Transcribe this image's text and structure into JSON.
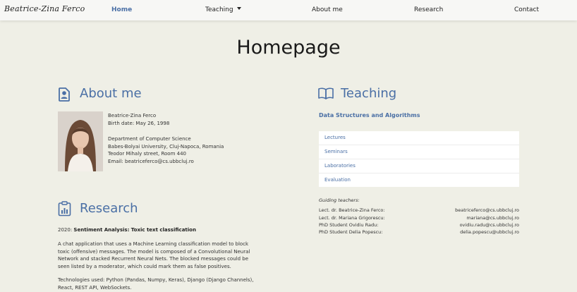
{
  "navbar": {
    "brand": "Beatrice-Zina Ferco",
    "links": {
      "home": "Home",
      "teaching": "Teaching",
      "about": "About me",
      "research": "Research",
      "contact": "Contact"
    },
    "active": "Home"
  },
  "page_title": "Homepage",
  "about": {
    "heading": "About me",
    "name": "Beatrice-Zina Ferco",
    "birth": "Birth date: May 26, 1998",
    "department": "Department of Computer Science",
    "university": "Babes-Bolyai University, Cluj-Napoca, Romania",
    "address": "Teodor Mihaly street, Room 440",
    "email": "Email: beatriceferco@cs.ubbcluj.ro"
  },
  "teaching": {
    "heading": "Teaching",
    "course_title": "Data Structures and Algorithms",
    "items": [
      "Lectures",
      "Seminars",
      "Laboratories",
      "Evaluation"
    ],
    "guiding_label": "Guiding teachers:",
    "teachers": [
      {
        "name": "Lect. dr. Beatrice-Zina Ferco:",
        "email": "beatriceferco@cs.ubbcluj.ro"
      },
      {
        "name": "Lect. dr. Mariana Grigorescu:",
        "email": "mariana@cs.ubbcluj.ro"
      },
      {
        "name": "PhD Student Ovidiu Radu:",
        "email": "ovidiu.radu@cs.ubbcluj.ro"
      },
      {
        "name": "PhD Student Delia Popescu:",
        "email": "delia.popescu@ubbcluj.ro"
      }
    ]
  },
  "research": {
    "heading": "Research",
    "year": "2020:",
    "project_title": "Sentiment Analysis: Toxic text classification",
    "description": "A chat application that uses a Machine Learning classification model to block toxic (offensive) messages. The model is composed of a Convolutional Neural Network and stacked Recurrent Neural Nets. The blocked messages could be seen listed by a moderator, which could mark them as false positives.",
    "technologies": "Technologies used: Python (Pandas, Numpy, Keras), Django (Django Channels), React, REST API, WebSockets."
  },
  "colors": {
    "accent": "#4a6fa5",
    "background": "#efefe6",
    "navbar": "#f7f7f5"
  },
  "icons": {
    "about": "person-badge-icon",
    "teaching": "open-book-icon",
    "research": "clipboard-chart-icon",
    "teaching_caret": "caret-down-icon"
  }
}
